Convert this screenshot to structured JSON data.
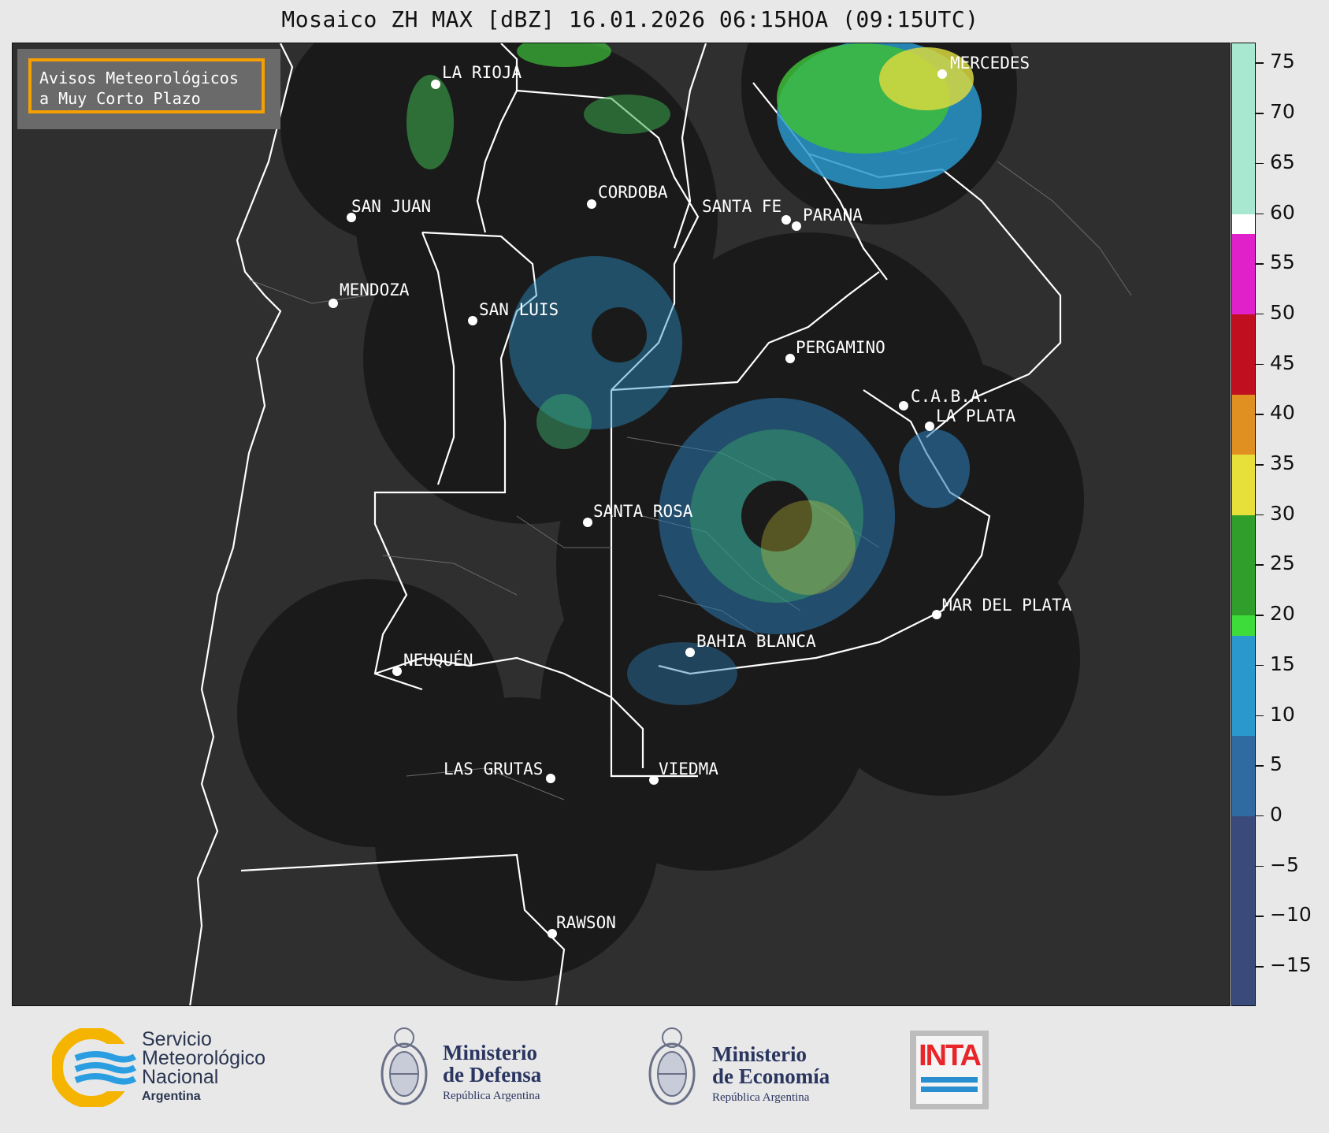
{
  "title": "Mosaico ZH MAX [dBZ] 16.01.2026 06:15HOA (09:15UTC)",
  "notice": {
    "line1": "Avisos Meteorológicos",
    "line2": "a Muy Corto Plazo"
  },
  "cities": [
    {
      "name": "LA RIOJA"
    },
    {
      "name": "CORDOBA"
    },
    {
      "name": "SAN JUAN"
    },
    {
      "name": "SANTA FE"
    },
    {
      "name": "PARANA"
    },
    {
      "name": "MERCEDES"
    },
    {
      "name": "MENDOZA"
    },
    {
      "name": "SAN LUIS"
    },
    {
      "name": "PERGAMINO"
    },
    {
      "name": "C.A.B.A."
    },
    {
      "name": "LA PLATA"
    },
    {
      "name": "SANTA ROSA"
    },
    {
      "name": "MAR DEL PLATA"
    },
    {
      "name": "BAHIA BLANCA"
    },
    {
      "name": "NEUQUÉN"
    },
    {
      "name": "LAS GRUTAS"
    },
    {
      "name": "VIEDMA"
    },
    {
      "name": "RAWSON"
    }
  ],
  "colorbar": {
    "unit": "dBZ",
    "range": [
      -19,
      77
    ],
    "ticks": [
      75,
      70,
      65,
      60,
      55,
      50,
      45,
      40,
      35,
      30,
      25,
      20,
      15,
      10,
      5,
      0,
      -5,
      -10,
      -15
    ],
    "tick_labels": [
      "75",
      "70",
      "65",
      "60",
      "55",
      "50",
      "45",
      "40",
      "35",
      "30",
      "25",
      "20",
      "15",
      "10",
      "5",
      "0",
      "−5",
      "−10",
      "−15"
    ],
    "bands": [
      {
        "from": -19,
        "to": 0,
        "color": "#3a4a7a"
      },
      {
        "from": 0,
        "to": 8,
        "color": "#2f6aa0"
      },
      {
        "from": 8,
        "to": 18,
        "color": "#2a98cc"
      },
      {
        "from": 18,
        "to": 20,
        "color": "#3ddc3a"
      },
      {
        "from": 20,
        "to": 30,
        "color": "#2f9e2a"
      },
      {
        "from": 30,
        "to": 36,
        "color": "#e8e03a"
      },
      {
        "from": 36,
        "to": 42,
        "color": "#e09020"
      },
      {
        "from": 42,
        "to": 50,
        "color": "#c01020"
      },
      {
        "from": 50,
        "to": 58,
        "color": "#e020c8"
      },
      {
        "from": 58,
        "to": 60,
        "color": "#ffffff"
      },
      {
        "from": 60,
        "to": 77,
        "color": "#a8e8d0"
      }
    ]
  },
  "logos": {
    "smn": {
      "line1": "Servicio",
      "line2": "Meteorológico",
      "line3": "Nacional",
      "line4": "Argentina"
    },
    "defensa": {
      "line1": "Ministerio",
      "line2": "de Defensa",
      "line3": "República Argentina"
    },
    "economia": {
      "line1": "Ministerio",
      "line2": "de Economía",
      "line3": "República Argentina"
    },
    "inta": {
      "text": "INTA"
    }
  },
  "colors": {
    "map_bg": "#2f2f2f",
    "radar_bg": "#1a1a1a",
    "notice_border": "#f5a000",
    "inta_red": "#e8262a",
    "smn_yellow": "#f5b400",
    "smn_blue": "#2a9ee0"
  }
}
